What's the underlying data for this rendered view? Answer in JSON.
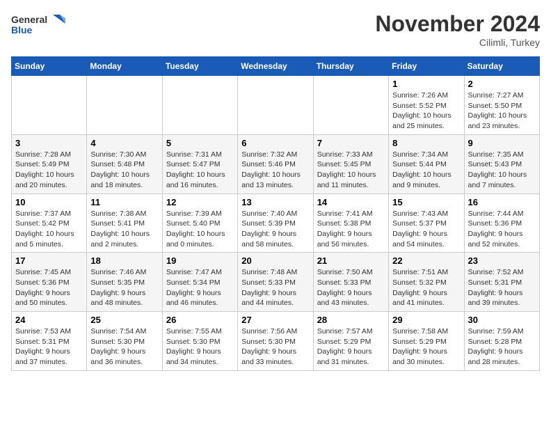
{
  "header": {
    "logo_general": "General",
    "logo_blue": "Blue",
    "month_title": "November 2024",
    "location": "Cilimli, Turkey"
  },
  "weekdays": [
    "Sunday",
    "Monday",
    "Tuesday",
    "Wednesday",
    "Thursday",
    "Friday",
    "Saturday"
  ],
  "weeks": [
    [
      {
        "day": "",
        "info": ""
      },
      {
        "day": "",
        "info": ""
      },
      {
        "day": "",
        "info": ""
      },
      {
        "day": "",
        "info": ""
      },
      {
        "day": "",
        "info": ""
      },
      {
        "day": "1",
        "info": "Sunrise: 7:26 AM\nSunset: 5:52 PM\nDaylight: 10 hours and 25 minutes."
      },
      {
        "day": "2",
        "info": "Sunrise: 7:27 AM\nSunset: 5:50 PM\nDaylight: 10 hours and 23 minutes."
      }
    ],
    [
      {
        "day": "3",
        "info": "Sunrise: 7:28 AM\nSunset: 5:49 PM\nDaylight: 10 hours and 20 minutes."
      },
      {
        "day": "4",
        "info": "Sunrise: 7:30 AM\nSunset: 5:48 PM\nDaylight: 10 hours and 18 minutes."
      },
      {
        "day": "5",
        "info": "Sunrise: 7:31 AM\nSunset: 5:47 PM\nDaylight: 10 hours and 16 minutes."
      },
      {
        "day": "6",
        "info": "Sunrise: 7:32 AM\nSunset: 5:46 PM\nDaylight: 10 hours and 13 minutes."
      },
      {
        "day": "7",
        "info": "Sunrise: 7:33 AM\nSunset: 5:45 PM\nDaylight: 10 hours and 11 minutes."
      },
      {
        "day": "8",
        "info": "Sunrise: 7:34 AM\nSunset: 5:44 PM\nDaylight: 10 hours and 9 minutes."
      },
      {
        "day": "9",
        "info": "Sunrise: 7:35 AM\nSunset: 5:43 PM\nDaylight: 10 hours and 7 minutes."
      }
    ],
    [
      {
        "day": "10",
        "info": "Sunrise: 7:37 AM\nSunset: 5:42 PM\nDaylight: 10 hours and 5 minutes."
      },
      {
        "day": "11",
        "info": "Sunrise: 7:38 AM\nSunset: 5:41 PM\nDaylight: 10 hours and 2 minutes."
      },
      {
        "day": "12",
        "info": "Sunrise: 7:39 AM\nSunset: 5:40 PM\nDaylight: 10 hours and 0 minutes."
      },
      {
        "day": "13",
        "info": "Sunrise: 7:40 AM\nSunset: 5:39 PM\nDaylight: 9 hours and 58 minutes."
      },
      {
        "day": "14",
        "info": "Sunrise: 7:41 AM\nSunset: 5:38 PM\nDaylight: 9 hours and 56 minutes."
      },
      {
        "day": "15",
        "info": "Sunrise: 7:43 AM\nSunset: 5:37 PM\nDaylight: 9 hours and 54 minutes."
      },
      {
        "day": "16",
        "info": "Sunrise: 7:44 AM\nSunset: 5:36 PM\nDaylight: 9 hours and 52 minutes."
      }
    ],
    [
      {
        "day": "17",
        "info": "Sunrise: 7:45 AM\nSunset: 5:36 PM\nDaylight: 9 hours and 50 minutes."
      },
      {
        "day": "18",
        "info": "Sunrise: 7:46 AM\nSunset: 5:35 PM\nDaylight: 9 hours and 48 minutes."
      },
      {
        "day": "19",
        "info": "Sunrise: 7:47 AM\nSunset: 5:34 PM\nDaylight: 9 hours and 46 minutes."
      },
      {
        "day": "20",
        "info": "Sunrise: 7:48 AM\nSunset: 5:33 PM\nDaylight: 9 hours and 44 minutes."
      },
      {
        "day": "21",
        "info": "Sunrise: 7:50 AM\nSunset: 5:33 PM\nDaylight: 9 hours and 43 minutes."
      },
      {
        "day": "22",
        "info": "Sunrise: 7:51 AM\nSunset: 5:32 PM\nDaylight: 9 hours and 41 minutes."
      },
      {
        "day": "23",
        "info": "Sunrise: 7:52 AM\nSunset: 5:31 PM\nDaylight: 9 hours and 39 minutes."
      }
    ],
    [
      {
        "day": "24",
        "info": "Sunrise: 7:53 AM\nSunset: 5:31 PM\nDaylight: 9 hours and 37 minutes."
      },
      {
        "day": "25",
        "info": "Sunrise: 7:54 AM\nSunset: 5:30 PM\nDaylight: 9 hours and 36 minutes."
      },
      {
        "day": "26",
        "info": "Sunrise: 7:55 AM\nSunset: 5:30 PM\nDaylight: 9 hours and 34 minutes."
      },
      {
        "day": "27",
        "info": "Sunrise: 7:56 AM\nSunset: 5:30 PM\nDaylight: 9 hours and 33 minutes."
      },
      {
        "day": "28",
        "info": "Sunrise: 7:57 AM\nSunset: 5:29 PM\nDaylight: 9 hours and 31 minutes."
      },
      {
        "day": "29",
        "info": "Sunrise: 7:58 AM\nSunset: 5:29 PM\nDaylight: 9 hours and 30 minutes."
      },
      {
        "day": "30",
        "info": "Sunrise: 7:59 AM\nSunset: 5:28 PM\nDaylight: 9 hours and 28 minutes."
      }
    ]
  ]
}
